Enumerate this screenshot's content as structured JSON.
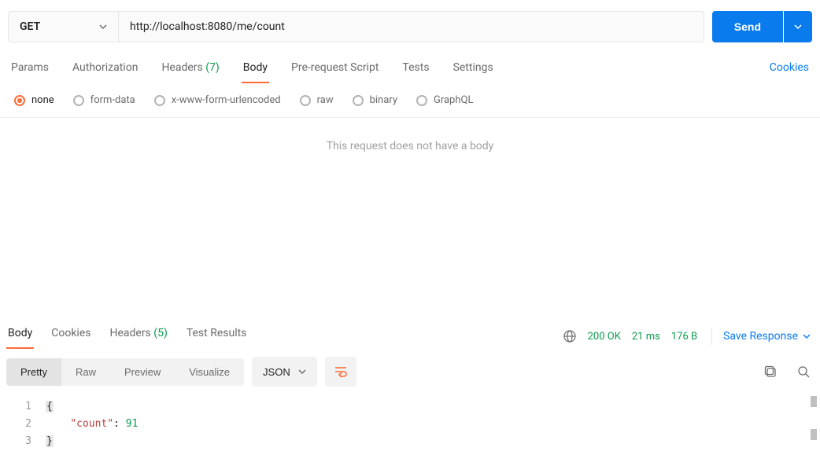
{
  "request": {
    "method": "GET",
    "url": "http://localhost:8080/me/count",
    "send_label": "Send"
  },
  "req_tabs": {
    "params": "Params",
    "authorization": "Authorization",
    "headers_label": "Headers",
    "headers_count": "(7)",
    "body": "Body",
    "prerequest": "Pre-request Script",
    "tests": "Tests",
    "settings": "Settings",
    "cookies": "Cookies"
  },
  "body_types": {
    "none": "none",
    "formdata": "form-data",
    "xwww": "x-www-form-urlencoded",
    "raw": "raw",
    "binary": "binary",
    "graphql": "GraphQL"
  },
  "empty_body_msg": "This request does not have a body",
  "resp_tabs": {
    "body": "Body",
    "cookies": "Cookies",
    "headers_label": "Headers",
    "headers_count": "(5)",
    "testresults": "Test Results"
  },
  "status": {
    "code": "200 OK",
    "time": "21 ms",
    "size": "176 B",
    "save": "Save Response"
  },
  "view": {
    "pretty": "Pretty",
    "raw": "Raw",
    "preview": "Preview",
    "visualize": "Visualize",
    "format": "JSON"
  },
  "response_body": {
    "line1_num": "1",
    "line1_text": "{",
    "line2_num": "2",
    "line2_indent": "    ",
    "line2_key": "\"count\"",
    "line2_colon": ": ",
    "line2_val": "91",
    "line3_num": "3",
    "line3_text": "}"
  }
}
